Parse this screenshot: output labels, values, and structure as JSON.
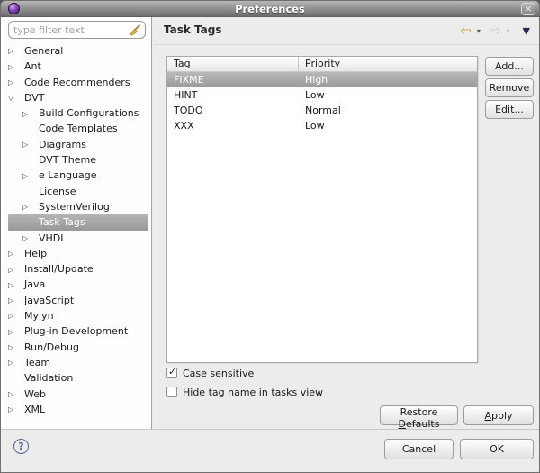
{
  "window": {
    "title": "Preferences",
    "close_glyph": "×"
  },
  "filter": {
    "placeholder": "type filter text"
  },
  "icons": {
    "tree_collapsed": "▷",
    "tree_expanded": "▽",
    "back": "⇦",
    "forward": "⇨",
    "menu_chevron": "▾",
    "view_menu": "▼",
    "check": "✓",
    "help": "?"
  },
  "colors": {
    "selection_gray": "#9b9b9b",
    "titlebar_gray": "#8d8d8d",
    "back_arrow_gold": "#cf9426",
    "disabled_gray": "#c8c8c6",
    "view_menu_navy": "#272c54",
    "help_blue": "#4a689e"
  },
  "sidebar": {
    "items": [
      {
        "label": "General",
        "level": 0,
        "state": "collapsed",
        "selected": false
      },
      {
        "label": "Ant",
        "level": 0,
        "state": "collapsed",
        "selected": false
      },
      {
        "label": "Code Recommenders",
        "level": 0,
        "state": "collapsed",
        "selected": false
      },
      {
        "label": "DVT",
        "level": 0,
        "state": "expanded",
        "selected": false
      },
      {
        "label": "Build Configurations",
        "level": 1,
        "state": "collapsed",
        "selected": false
      },
      {
        "label": "Code Templates",
        "level": 1,
        "state": "none",
        "selected": false
      },
      {
        "label": "Diagrams",
        "level": 1,
        "state": "collapsed",
        "selected": false
      },
      {
        "label": "DVT Theme",
        "level": 1,
        "state": "none",
        "selected": false
      },
      {
        "label": "e Language",
        "level": 1,
        "state": "collapsed",
        "selected": false
      },
      {
        "label": "License",
        "level": 1,
        "state": "none",
        "selected": false
      },
      {
        "label": "SystemVerilog",
        "level": 1,
        "state": "collapsed",
        "selected": false
      },
      {
        "label": "Task Tags",
        "level": 1,
        "state": "none",
        "selected": true
      },
      {
        "label": "VHDL",
        "level": 1,
        "state": "collapsed",
        "selected": false
      },
      {
        "label": "Help",
        "level": 0,
        "state": "collapsed",
        "selected": false
      },
      {
        "label": "Install/Update",
        "level": 0,
        "state": "collapsed",
        "selected": false
      },
      {
        "label": "Java",
        "level": 0,
        "state": "collapsed",
        "selected": false
      },
      {
        "label": "JavaScript",
        "level": 0,
        "state": "collapsed",
        "selected": false
      },
      {
        "label": "Mylyn",
        "level": 0,
        "state": "collapsed",
        "selected": false
      },
      {
        "label": "Plug-in Development",
        "level": 0,
        "state": "collapsed",
        "selected": false
      },
      {
        "label": "Run/Debug",
        "level": 0,
        "state": "collapsed",
        "selected": false
      },
      {
        "label": "Team",
        "level": 0,
        "state": "collapsed",
        "selected": false
      },
      {
        "label": "Validation",
        "level": 0,
        "state": "none",
        "selected": false
      },
      {
        "label": "Web",
        "level": 0,
        "state": "collapsed",
        "selected": false
      },
      {
        "label": "XML",
        "level": 0,
        "state": "collapsed",
        "selected": false
      }
    ]
  },
  "header": {
    "title": "Task Tags"
  },
  "table": {
    "columns": [
      "Tag",
      "Priority"
    ],
    "rows": [
      {
        "tag": "FIXME",
        "priority": "High",
        "selected": true
      },
      {
        "tag": "HINT",
        "priority": "Low",
        "selected": false
      },
      {
        "tag": "TODO",
        "priority": "Normal",
        "selected": false
      },
      {
        "tag": "XXX",
        "priority": "Low",
        "selected": false
      }
    ]
  },
  "side_buttons": {
    "add": "Add...",
    "remove": "Remove",
    "edit": "Edit..."
  },
  "checkboxes": [
    {
      "label": "Case sensitive",
      "checked": true
    },
    {
      "label": "Hide tag name in tasks view",
      "checked": false
    }
  ],
  "action_buttons": {
    "restore": {
      "pre": "Restore ",
      "accel": "D",
      "post": "efaults"
    },
    "apply": {
      "pre": "",
      "accel": "A",
      "post": "pply"
    }
  },
  "dialog_buttons": {
    "cancel": "Cancel",
    "ok": "OK"
  }
}
